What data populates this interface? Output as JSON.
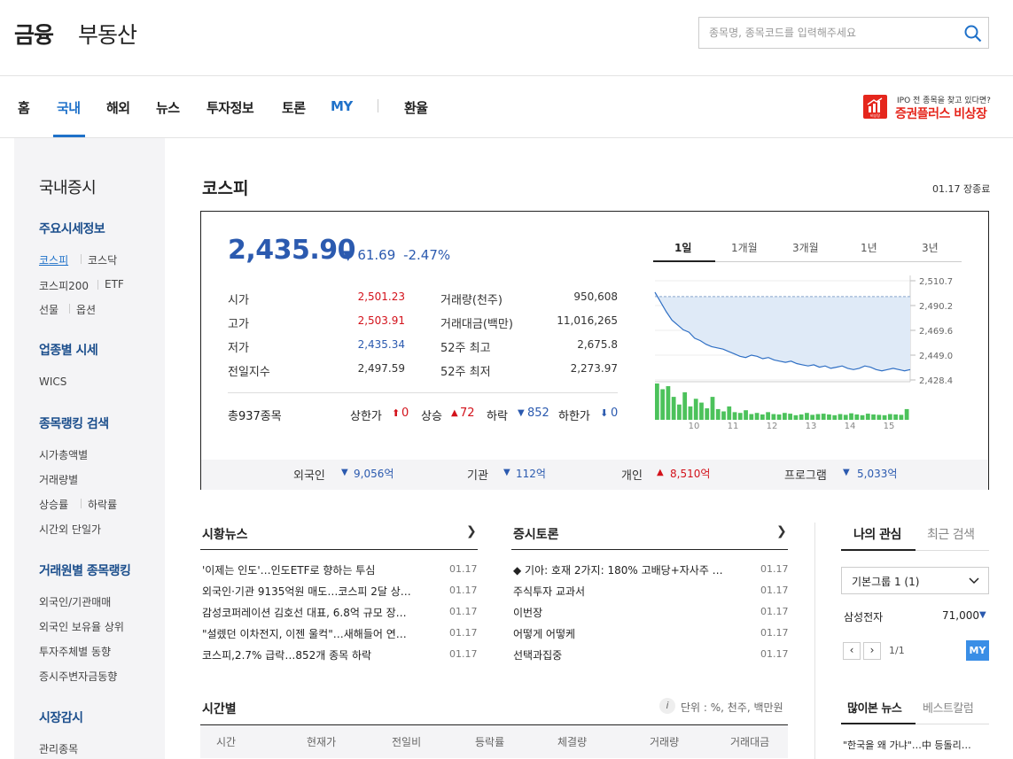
{
  "header": {
    "logo_finance": "금융",
    "logo_realestate": "부동산",
    "search_placeholder": "종목명, 종목코드를 입력해주세요"
  },
  "nav": {
    "items": [
      "홈",
      "국내",
      "해외",
      "뉴스",
      "투자정보",
      "토론",
      "MY",
      "환율"
    ],
    "active": "국내"
  },
  "ad": {
    "small_text": "IPO 전 종목을 찾고 있다면?",
    "big_text": "증권플러스 비상장",
    "icon_text": "비상장"
  },
  "sidebar": {
    "title": "국내증시",
    "sections": [
      {
        "head": "주요시세정보",
        "rows": [
          [
            "코스피",
            "코스닥"
          ],
          [
            "코스피200",
            "ETF"
          ],
          [
            "선물",
            "옵션"
          ]
        ]
      },
      {
        "head": "업종별 시세",
        "rows": [
          [
            "WICS"
          ]
        ]
      },
      {
        "head": "종목랭킹 검색",
        "rows": [
          [
            "시가총액별"
          ],
          [
            "거래량별"
          ],
          [
            "상승률",
            "하락률"
          ],
          [
            "시간외 단일가"
          ]
        ]
      },
      {
        "head": "거래원별 종목랭킹",
        "rows": [
          [
            "외국인/기관매매"
          ],
          [
            "외국인 보유율 상위"
          ],
          [
            "투자주체별 동향"
          ],
          [
            "증시주변자금동향"
          ]
        ]
      },
      {
        "head": "시장감시",
        "rows": [
          [
            "관리종목"
          ]
        ]
      }
    ]
  },
  "kospi": {
    "title": "코스피",
    "status": "01.17 장종료",
    "price": "2,435.90",
    "change_arrow": "▼",
    "change": "61.69",
    "change_pct": "-2.47%",
    "stats_left": [
      {
        "label": "시가",
        "value": "2,501.23",
        "color": "red"
      },
      {
        "label": "고가",
        "value": "2,503.91",
        "color": "red"
      },
      {
        "label": "저가",
        "value": "2,435.34",
        "color": "blue"
      },
      {
        "label": "전일지수",
        "value": "2,497.59",
        "color": "dark"
      }
    ],
    "stats_right": [
      {
        "label": "거래량(천주)",
        "value": "950,608"
      },
      {
        "label": "거래대금(백만)",
        "value": "11,016,265"
      },
      {
        "label": "52주 최고",
        "value": "2,675.8"
      },
      {
        "label": "52주 최저",
        "value": "2,273.97"
      }
    ],
    "breadth": {
      "total": "총937종목",
      "upper_limit_label": "상한가",
      "upper_limit": "0",
      "up_label": "상승",
      "up": "72",
      "down_label": "하락",
      "down": "852",
      "lower_limit_label": "하한가",
      "lower_limit": "0"
    },
    "period_tabs": [
      "1일",
      "1개월",
      "3개월",
      "1년",
      "3년"
    ],
    "flows": [
      {
        "label": "외국인",
        "arrow": "▼",
        "value": "9,056억",
        "color": "blue"
      },
      {
        "label": "기관",
        "arrow": "▼",
        "value": "112억",
        "color": "blue"
      },
      {
        "label": "개인",
        "arrow": "▲",
        "value": "8,510억",
        "color": "red"
      },
      {
        "label": "프로그램",
        "arrow": "▼",
        "value": "5,033억",
        "color": "blue"
      }
    ]
  },
  "chart_data": {
    "type": "line",
    "title": "",
    "x_ticks": [
      "10",
      "11",
      "12",
      "13",
      "14",
      "15"
    ],
    "y_ticks": [
      "2,510.7",
      "2,490.2",
      "2,469.6",
      "2,449.0",
      "2,428.4"
    ],
    "ylim": [
      2428.4,
      2510.7
    ],
    "previous_close": 2497.59,
    "series": [
      {
        "values": [
          2501.2,
          2493,
          2485,
          2478,
          2474,
          2470,
          2468,
          2463,
          2461,
          2458,
          2456,
          2455,
          2454,
          2452,
          2450,
          2448,
          2447,
          2449,
          2448,
          2446,
          2447,
          2445,
          2444,
          2443,
          2444,
          2442,
          2441,
          2440,
          2441,
          2439,
          2440,
          2438,
          2439,
          2440,
          2438,
          2437,
          2438,
          2440,
          2439,
          2437,
          2436,
          2437,
          2438,
          2437,
          2436,
          2437
        ]
      }
    ],
    "volume": [
      95,
      80,
      88,
      60,
      40,
      72,
      35,
      55,
      45,
      30,
      60,
      28,
      22,
      35,
      20,
      18,
      25,
      15,
      18,
      14,
      20,
      15,
      14,
      18,
      16,
      12,
      14,
      18,
      13,
      15,
      16,
      14,
      12,
      15,
      13,
      17,
      14,
      12,
      16,
      14,
      13,
      12,
      15,
      14,
      13,
      28
    ]
  },
  "news": {
    "title": "시황뉴스",
    "items": [
      {
        "text": "'이제는 인도'…인도ETF로 향하는 투심",
        "date": "01.17"
      },
      {
        "text": "외국인·기관 9135억원 매도…코스피 2달 상…",
        "date": "01.17"
      },
      {
        "text": "감성코퍼레이션 김호선 대표, 6.8억 규모 장…",
        "date": "01.17"
      },
      {
        "text": "\"설렜던 이차전지, 이젠 울컥\"…새해들어 연…",
        "date": "01.17"
      },
      {
        "text": "코스피,2.7% 급락…852개 종목 하락",
        "date": "01.17"
      }
    ]
  },
  "forum": {
    "title": "증시토론",
    "items": [
      {
        "text": "◆ 기아: 호재 2가지: 180% 고배당+자사주 …",
        "date": "01.17"
      },
      {
        "text": "주식투자 교과서",
        "date": "01.17"
      },
      {
        "text": "이번장",
        "date": "01.17"
      },
      {
        "text": "어떻게 어떻케",
        "date": "01.17"
      },
      {
        "text": "선택과집중",
        "date": "01.17"
      }
    ]
  },
  "watch": {
    "tabs": [
      "나의 관심",
      "최근 검색"
    ],
    "group": "기본그룹 1 (1)",
    "stock_name": "삼성전자",
    "stock_price": "71,000",
    "stock_arrow": "▼",
    "page": "1/1",
    "my_label": "MY"
  },
  "popular": {
    "tabs": [
      "많이본 뉴스",
      "베스트칼럼"
    ],
    "first": "\"한국을 왜 가냐\"…中 등돌리…"
  },
  "time_table": {
    "title": "시간별",
    "unit": "단위 : %, 천주, 백만원",
    "headers": [
      "시간",
      "현재가",
      "전일비",
      "등락률",
      "체결량",
      "거래량",
      "거래대금"
    ]
  },
  "colors": {
    "accent": "#1f71c9",
    "up": "#d3121b",
    "down": "#2b5aaf",
    "volume": "#4cc25b"
  }
}
